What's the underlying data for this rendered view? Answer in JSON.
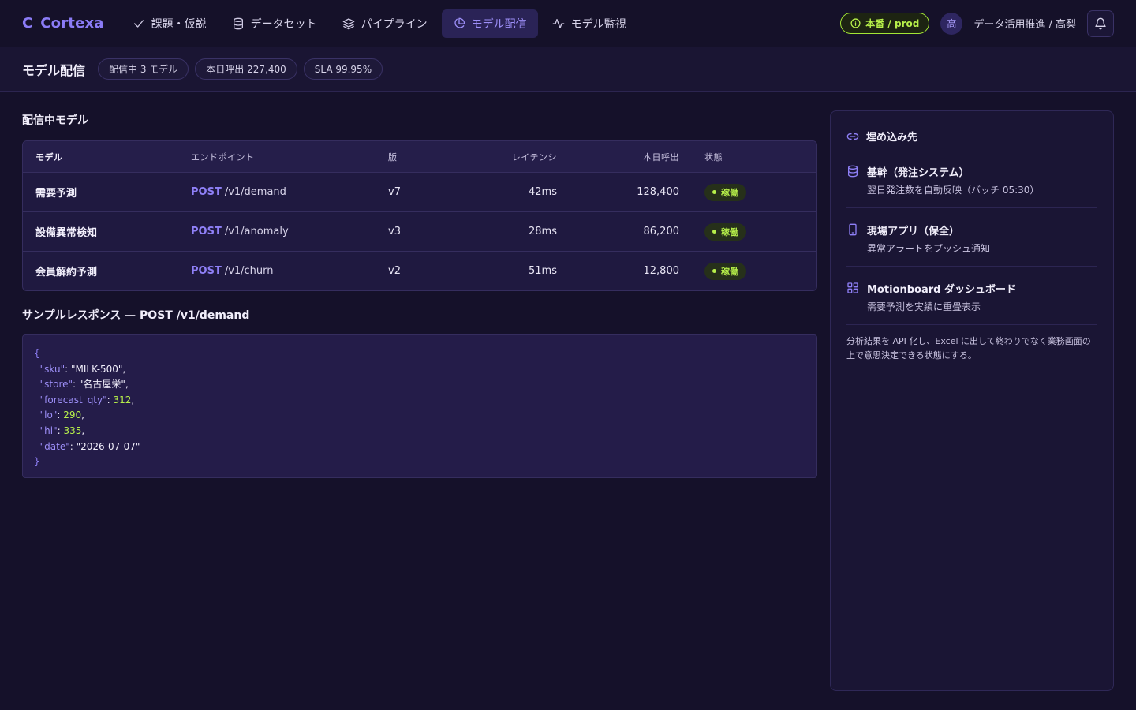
{
  "brand": {
    "mark": "C",
    "name": "Cortexa"
  },
  "nav": [
    {
      "label": "課題・仮説",
      "icon": "check-icon"
    },
    {
      "label": "データセット",
      "icon": "database-icon"
    },
    {
      "label": "パイプライン",
      "icon": "layers-icon"
    },
    {
      "label": "モデル配信",
      "icon": "pie-chart-icon",
      "active": true
    },
    {
      "label": "モデル監視",
      "icon": "activity-icon"
    }
  ],
  "header_right": {
    "env_label": "本番 / prod",
    "avatar_initial": "高",
    "user": "データ活用推進 / 高梨"
  },
  "subheader": {
    "title": "モデル配信",
    "pills": [
      "配信中 3 モデル",
      "本日呼出 227,400",
      "SLA 99.95%"
    ]
  },
  "models_section": {
    "title": "配信中モデル",
    "columns": [
      "モデル",
      "エンドポイント",
      "版",
      "レイテンシ",
      "本日呼出",
      "状態"
    ],
    "rows": [
      {
        "model": "需要予測",
        "method": "POST",
        "path": "/v1/demand",
        "version": "v7",
        "latency": "42ms",
        "calls": "128,400",
        "status": "稼働"
      },
      {
        "model": "設備異常検知",
        "method": "POST",
        "path": "/v1/anomaly",
        "version": "v3",
        "latency": "28ms",
        "calls": "86,200",
        "status": "稼働"
      },
      {
        "model": "会員解約予測",
        "method": "POST",
        "path": "/v1/churn",
        "version": "v2",
        "latency": "51ms",
        "calls": "12,800",
        "status": "稼働"
      }
    ]
  },
  "sample": {
    "title": "サンプルレスポンス — POST /v1/demand",
    "open": "{",
    "close": "}",
    "fields": [
      {
        "key": "\"sku\"",
        "value": "\"MILK-500\"",
        "type": "str",
        "comma": ","
      },
      {
        "key": "\"store\"",
        "value": "\"名古屋栄\"",
        "type": "str",
        "comma": ","
      },
      {
        "key": "\"forecast_qty\"",
        "value": "312",
        "type": "num",
        "comma": ","
      },
      {
        "key": "\"lo\"",
        "value": "290",
        "type": "num",
        "comma": ","
      },
      {
        "key": "\"hi\"",
        "value": "335",
        "type": "num",
        "comma": ","
      },
      {
        "key": "\"date\"",
        "value": "\"2026-07-07\"",
        "type": "str",
        "comma": ""
      }
    ]
  },
  "embed": {
    "title": "埋め込み先",
    "items": [
      {
        "icon": "database-icon",
        "title": "基幹（発注システム）",
        "desc": "翌日発注数を自動反映（バッチ 05:30）"
      },
      {
        "icon": "smartphone-icon",
        "title": "現場アプリ（保全）",
        "desc": "異常アラートをプッシュ通知"
      },
      {
        "icon": "grid-icon",
        "title": "Motionboard ダッシュボード",
        "desc": "需要予測を実績に重畳表示"
      }
    ],
    "note": "分析結果を API 化し、Excel に出して終わりでなく業務画面の上で意思決定できる状態にする。"
  },
  "colors": {
    "accent": "#8b7cf6",
    "status_ok": "#b7f04a",
    "background": "#15112a"
  }
}
